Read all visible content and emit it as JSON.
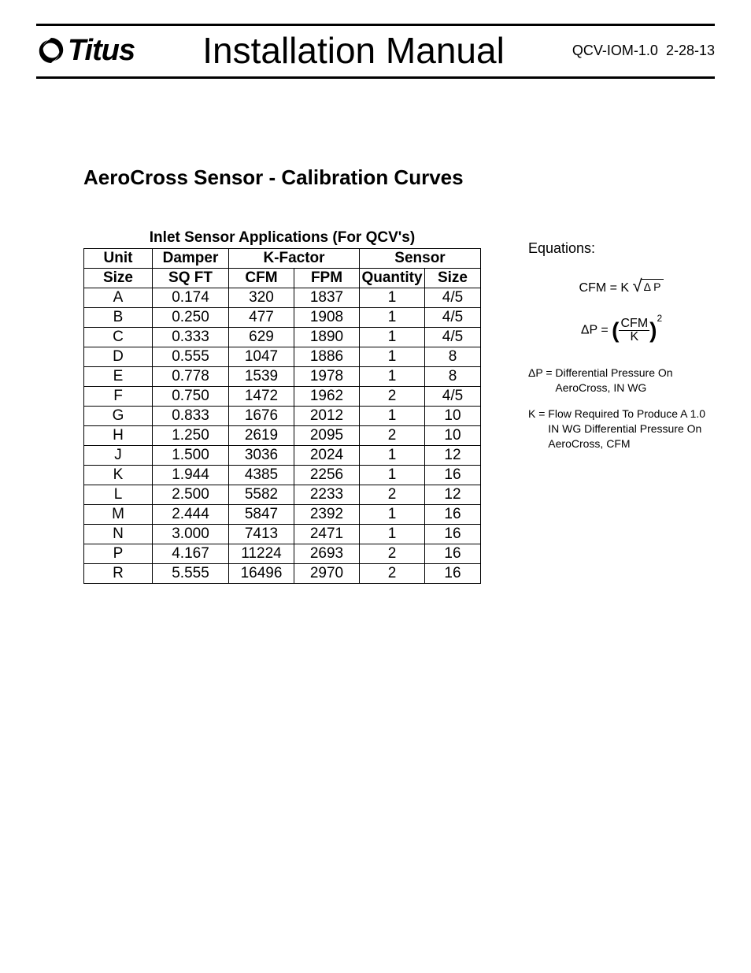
{
  "header": {
    "brand": "Titus",
    "title": "Installation Manual",
    "doc_id": "QCV-IOM-1.0  2-28-13"
  },
  "section_title": "AeroCross Sensor - Calibration Curves",
  "table": {
    "caption": "Inlet Sensor Applications (For QCV's)",
    "head_top": {
      "unit": "Unit",
      "damper": "Damper",
      "kfactor": "K-Factor",
      "sensor": "Sensor"
    },
    "head_sub": {
      "size": "Size",
      "sqft": "SQ FT",
      "cfm": "CFM",
      "fpm": "FPM",
      "qty": "Quantity",
      "ssize": "Size"
    },
    "rows": [
      {
        "unit": "A",
        "sqft": "0.174",
        "cfm": "320",
        "fpm": "1837",
        "qty": "1",
        "ssize": "4/5"
      },
      {
        "unit": "B",
        "sqft": "0.250",
        "cfm": "477",
        "fpm": "1908",
        "qty": "1",
        "ssize": "4/5"
      },
      {
        "unit": "C",
        "sqft": "0.333",
        "cfm": "629",
        "fpm": "1890",
        "qty": "1",
        "ssize": "4/5"
      },
      {
        "unit": "D",
        "sqft": "0.555",
        "cfm": "1047",
        "fpm": "1886",
        "qty": "1",
        "ssize": "8"
      },
      {
        "unit": "E",
        "sqft": "0.778",
        "cfm": "1539",
        "fpm": "1978",
        "qty": "1",
        "ssize": "8"
      },
      {
        "unit": "F",
        "sqft": "0.750",
        "cfm": "1472",
        "fpm": "1962",
        "qty": "2",
        "ssize": "4/5"
      },
      {
        "unit": "G",
        "sqft": "0.833",
        "cfm": "1676",
        "fpm": "2012",
        "qty": "1",
        "ssize": "10"
      },
      {
        "unit": "H",
        "sqft": "1.250",
        "cfm": "2619",
        "fpm": "2095",
        "qty": "2",
        "ssize": "10"
      },
      {
        "unit": "J",
        "sqft": "1.500",
        "cfm": "3036",
        "fpm": "2024",
        "qty": "1",
        "ssize": "12"
      },
      {
        "unit": "K",
        "sqft": "1.944",
        "cfm": "4385",
        "fpm": "2256",
        "qty": "1",
        "ssize": "16"
      },
      {
        "unit": "L",
        "sqft": "2.500",
        "cfm": "5582",
        "fpm": "2233",
        "qty": "2",
        "ssize": "12"
      },
      {
        "unit": "M",
        "sqft": "2.444",
        "cfm": "5847",
        "fpm": "2392",
        "qty": "1",
        "ssize": "16"
      },
      {
        "unit": "N",
        "sqft": "3.000",
        "cfm": "7413",
        "fpm": "2471",
        "qty": "1",
        "ssize": "16"
      },
      {
        "unit": "P",
        "sqft": "4.167",
        "cfm": "11224",
        "fpm": "2693",
        "qty": "2",
        "ssize": "16"
      },
      {
        "unit": "R",
        "sqft": "5.555",
        "cfm": "16496",
        "fpm": "2970",
        "qty": "2",
        "ssize": "16"
      }
    ]
  },
  "equations": {
    "label": "Equations:",
    "eq1": {
      "lhs": "CFM = K",
      "delta": "Δ",
      "p": "P"
    },
    "eq2": {
      "lhs": "ΔP =",
      "num": "CFM",
      "den": "K"
    },
    "def_dp_sym": "ΔP = ",
    "def_dp_txt": "Differential Pressure On AeroCross, IN WG",
    "def_k_sym": "K = ",
    "def_k_txt": "Flow Required To Produce A 1.0 IN WG Differential Pressure On AeroCross, CFM"
  }
}
